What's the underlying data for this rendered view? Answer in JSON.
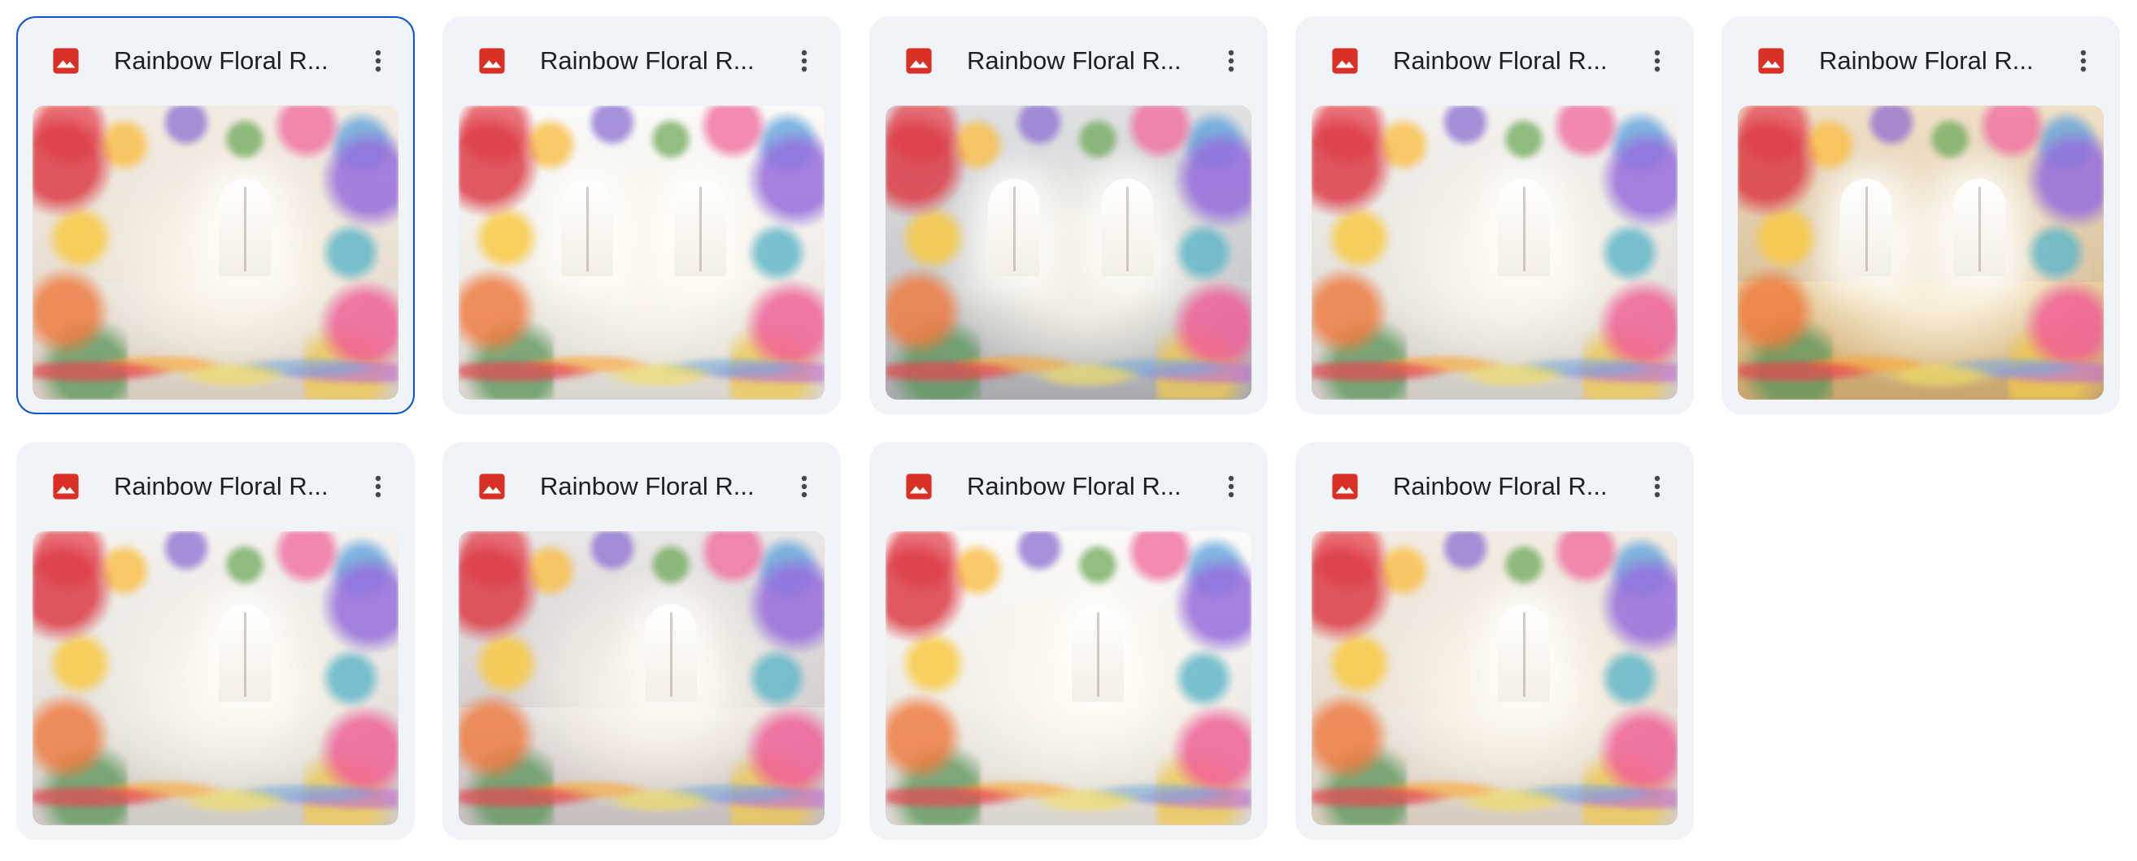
{
  "files": [
    {
      "name": "Rainbow Floral R...",
      "selected": true,
      "icon": "image-file-icon",
      "icon_color": "#d93025",
      "tone": "warm-haze",
      "windows": 1
    },
    {
      "name": "Rainbow Floral R...",
      "selected": false,
      "icon": "image-file-icon",
      "icon_color": "#d93025",
      "tone": "white-bright",
      "windows": 2
    },
    {
      "name": "Rainbow Floral R...",
      "selected": false,
      "icon": "image-file-icon",
      "icon_color": "#d93025",
      "tone": "grey-cool",
      "windows": 2
    },
    {
      "name": "Rainbow Floral R...",
      "selected": false,
      "icon": "image-file-icon",
      "icon_color": "#d93025",
      "tone": "white-soft",
      "windows": 1
    },
    {
      "name": "Rainbow Floral R...",
      "selected": false,
      "icon": "image-file-icon",
      "icon_color": "#d93025",
      "tone": "golden",
      "windows": 2
    },
    {
      "name": "Rainbow Floral R...",
      "selected": false,
      "icon": "image-file-icon",
      "icon_color": "#d93025",
      "tone": "white-soft",
      "windows": 1
    },
    {
      "name": "Rainbow Floral R...",
      "selected": false,
      "icon": "image-file-icon",
      "icon_color": "#d93025",
      "tone": "corridor",
      "windows": 1
    },
    {
      "name": "Rainbow Floral R...",
      "selected": false,
      "icon": "image-file-icon",
      "icon_color": "#d93025",
      "tone": "white-bright",
      "windows": 1
    },
    {
      "name": "Rainbow Floral R...",
      "selected": false,
      "icon": "image-file-icon",
      "icon_color": "#d93025",
      "tone": "warm-haze",
      "windows": 1
    }
  ],
  "menu_icon": "more-vertical-icon",
  "colors": {
    "card_background": "#f0f4f9",
    "selected_border": "#0b57d0",
    "text": "#1f1f1f",
    "menu_icon": "#444746"
  }
}
